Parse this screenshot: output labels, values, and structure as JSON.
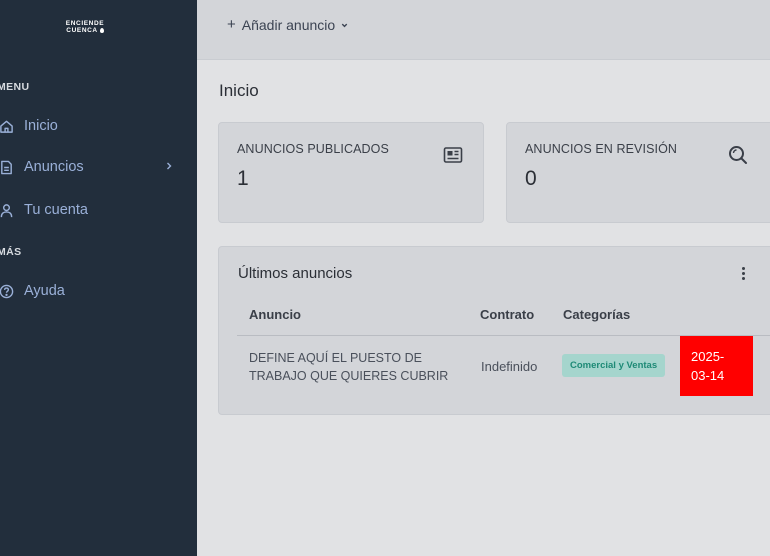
{
  "sidebar": {
    "logo_line1": "ENCIENDE",
    "logo_line2": "CUENCA",
    "menu_title": "MENU",
    "more_title": "MÁS",
    "items": [
      {
        "label": "Inicio",
        "icon": "home-icon"
      },
      {
        "label": "Anuncios",
        "icon": "document-icon"
      },
      {
        "label": "Tu cuenta",
        "icon": "user-icon"
      },
      {
        "label": "Ayuda",
        "icon": "help-circle-icon"
      }
    ]
  },
  "topbar": {
    "add_label": "Añadir anuncio",
    "add_icon": "plus-icon"
  },
  "page": {
    "title": "Inicio"
  },
  "stats": [
    {
      "label": "ANUNCIOS PUBLICADOS",
      "value": "1",
      "icon": "newspaper-icon"
    },
    {
      "label": "ANUNCIOS EN REVISIÓN",
      "value": "0",
      "icon": "search-icon"
    }
  ],
  "latest": {
    "title": "Últimos anuncios",
    "columns": [
      "Anuncio",
      "Contrato",
      "Categorías"
    ],
    "rows": [
      {
        "anuncio": "DEFINE AQUÍ EL PUESTO DE TRABAJO QUE QUIERES CUBRIR",
        "contrato": "Indefinido",
        "categoria": "Comercial y Ventas",
        "fecha_line1": "2025-",
        "fecha_line2": "03-14"
      }
    ]
  },
  "colors": {
    "sidebar_bg": "#222e3c",
    "nav_text": "#9ab0d8",
    "badge_bg": "#a5d5cd",
    "badge_text": "#1e8a76",
    "date_bg": "#ff0000"
  }
}
